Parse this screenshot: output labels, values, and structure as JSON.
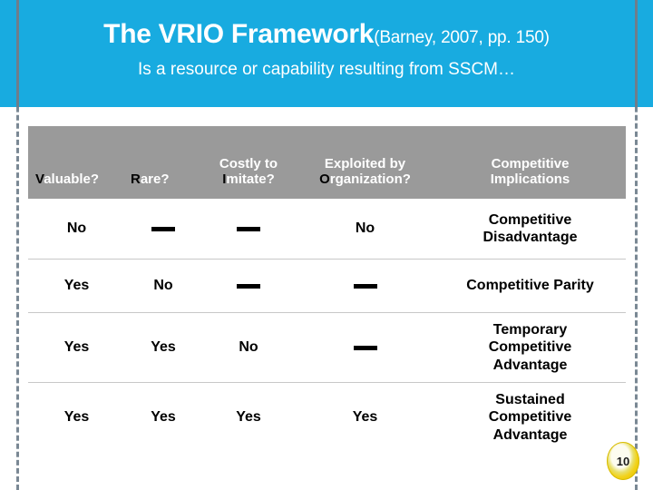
{
  "slide": {
    "header": {
      "title_main": "The VRIO Framework",
      "title_citation": "(Barney, 2007, pp. 150)",
      "subtitle": "Is a resource or capability resulting from SSCM…",
      "background_color": "#18ABE0",
      "text_color": "#FFFFFF"
    },
    "table": {
      "header_background": "#9A9A9A",
      "header_text_color": "#FFFFFF",
      "vrio_letter_color": "#000000",
      "columns": [
        {
          "key": "valuable",
          "initial": "V",
          "rest": "aluable?",
          "line1": "",
          "line2": "Valuable?"
        },
        {
          "key": "rare",
          "initial": "R",
          "rest": "are?",
          "line1": "",
          "line2": "Rare?"
        },
        {
          "key": "imitate",
          "initial": "I",
          "rest": "mitate?",
          "line1": "Costly to",
          "line2": "Imitate?"
        },
        {
          "key": "organization",
          "initial": "O",
          "rest": "rganization?",
          "line1": "Exploited by",
          "line2": "Organization?"
        },
        {
          "key": "implications",
          "initial": "",
          "rest": "",
          "line1": "Competitive",
          "line2": "Implications"
        }
      ],
      "rows": [
        {
          "valuable": "No",
          "rare": "—",
          "imitate": "—",
          "organization": "No",
          "implications": [
            "Competitive",
            "Disadvantage"
          ]
        },
        {
          "valuable": "Yes",
          "rare": "No",
          "imitate": "—",
          "organization": "—",
          "implications": [
            "Competitive Parity"
          ]
        },
        {
          "valuable": "Yes",
          "rare": "Yes",
          "imitate": "No",
          "organization": "—",
          "implications": [
            "Temporary",
            "Competitive",
            "Advantage"
          ]
        },
        {
          "valuable": "Yes",
          "rare": "Yes",
          "imitate": "Yes",
          "organization": "Yes",
          "implications": [
            "Sustained",
            "Competitive",
            "Advantage"
          ]
        }
      ]
    },
    "page_badge": {
      "number": "10",
      "color": "#F2D21A"
    }
  }
}
